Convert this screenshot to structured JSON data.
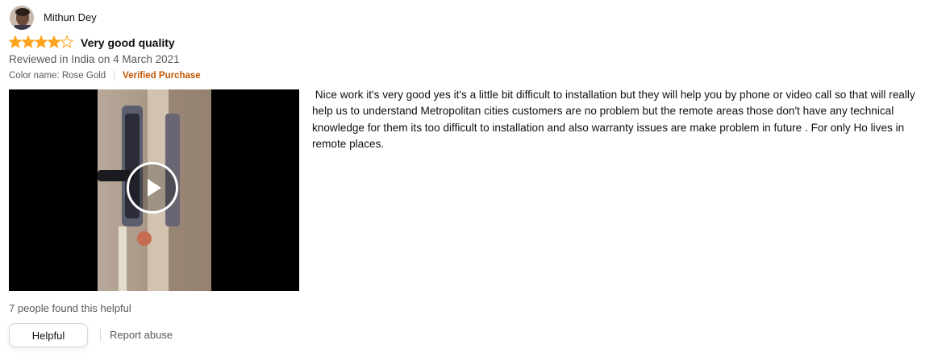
{
  "review": {
    "reviewer_name": "Mithun Dey",
    "rating": 4,
    "rating_max": 5,
    "title": "Very good quality",
    "date_line": "Reviewed in India on 4 March 2021",
    "variant": "Color name: Rose Gold",
    "verified_label": "Verified Purchase",
    "body": " Nice work it's very good yes it's a little bit difficult to installation but they will help you by phone or video call so that will really help us to understand Metropolitan cities customers are no problem but the remote areas those don't have any technical knowledge for them its too difficult to installation and also warranty issues are make problem in future . For only Ho lives in remote places."
  },
  "video": {
    "icon": "play-icon"
  },
  "footer": {
    "helpful_count": "7 people found this helpful",
    "helpful_button": "Helpful",
    "report_link": "Report abuse"
  },
  "colors": {
    "star": "#ffa41c",
    "verified": "#c45500",
    "secondary_text": "#565959"
  }
}
